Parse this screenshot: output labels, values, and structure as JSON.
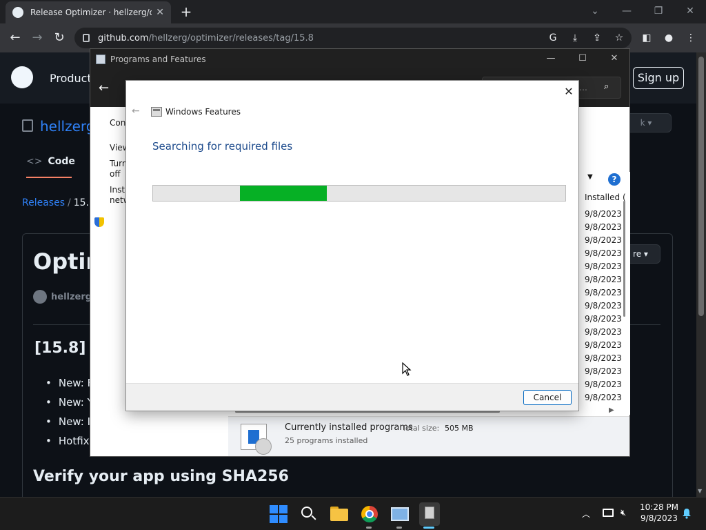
{
  "browser": {
    "tab_title": "Release Optimizer · hellzerg/optimizer",
    "url_host": "github.com",
    "url_path": "/hellzerg/optimizer/releases/tag/15.8"
  },
  "github": {
    "nav_product": "Product",
    "signup": "Sign up",
    "repo_owner": "hellzerg",
    "code_tab": "Code",
    "breadcrumb_releases": "Releases",
    "breadcrumb_sep": "/",
    "breadcrumb_tag": "15.8",
    "release_title": "Optim",
    "author": "hellzerg",
    "section_heading": "[15.8] -",
    "bullets": [
      "New: F",
      "New: Y",
      "New: Ir",
      "Hotfix:"
    ],
    "verify_heading": "Verify your app using SHA256",
    "btn_partial_1": "k",
    "btn_partial_2": "re"
  },
  "programs_features": {
    "title": "Programs and Features",
    "search_placeholder": "tu...",
    "left_links": [
      "Cont",
      "View",
      "Turn",
      "off",
      "Insta",
      "netw"
    ],
    "column_header": "Installed (",
    "dates": [
      "9/8/2023",
      "9/8/2023",
      "9/8/2023",
      "9/8/2023",
      "9/8/2023",
      "9/8/2023",
      "9/8/2023",
      "9/8/2023",
      "9/8/2023",
      "9/8/2023",
      "9/8/2023",
      "9/8/2023",
      "9/8/2023",
      "9/8/2023",
      "9/8/2023"
    ],
    "status_main": "Currently installed programs",
    "total_size_label": "Total size:",
    "total_size_value": "505 MB",
    "program_count": "25 programs installed"
  },
  "windows_features": {
    "title": "Windows Features",
    "heading": "Searching for required files",
    "progress": {
      "start": 0.21,
      "end": 0.42
    },
    "cancel": "Cancel"
  },
  "taskbar": {
    "time": "10:28 PM",
    "date": "9/8/2023"
  },
  "colors": {
    "progress_fill": "#06b025",
    "github_link": "#2f81f7",
    "heading_blue": "#1c4a8c",
    "start_blue": "#2f8cff"
  }
}
